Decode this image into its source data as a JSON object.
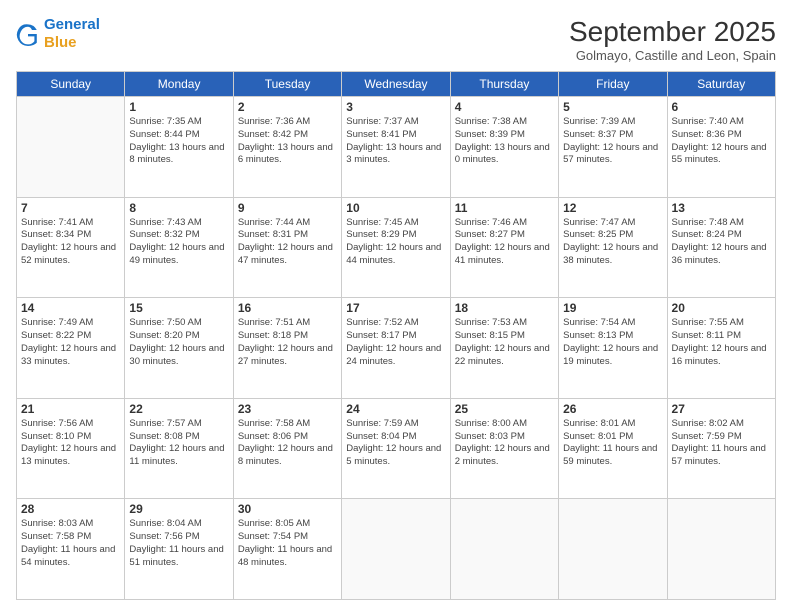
{
  "header": {
    "logo_line1": "General",
    "logo_line2": "Blue",
    "month_title": "September 2025",
    "location": "Golmayo, Castille and Leon, Spain"
  },
  "weekdays": [
    "Sunday",
    "Monday",
    "Tuesday",
    "Wednesday",
    "Thursday",
    "Friday",
    "Saturday"
  ],
  "weeks": [
    [
      {
        "day": null,
        "info": null
      },
      {
        "day": "1",
        "info": "Sunrise: 7:35 AM\nSunset: 8:44 PM\nDaylight: 13 hours\nand 8 minutes."
      },
      {
        "day": "2",
        "info": "Sunrise: 7:36 AM\nSunset: 8:42 PM\nDaylight: 13 hours\nand 6 minutes."
      },
      {
        "day": "3",
        "info": "Sunrise: 7:37 AM\nSunset: 8:41 PM\nDaylight: 13 hours\nand 3 minutes."
      },
      {
        "day": "4",
        "info": "Sunrise: 7:38 AM\nSunset: 8:39 PM\nDaylight: 13 hours\nand 0 minutes."
      },
      {
        "day": "5",
        "info": "Sunrise: 7:39 AM\nSunset: 8:37 PM\nDaylight: 12 hours\nand 57 minutes."
      },
      {
        "day": "6",
        "info": "Sunrise: 7:40 AM\nSunset: 8:36 PM\nDaylight: 12 hours\nand 55 minutes."
      }
    ],
    [
      {
        "day": "7",
        "info": "Sunrise: 7:41 AM\nSunset: 8:34 PM\nDaylight: 12 hours\nand 52 minutes."
      },
      {
        "day": "8",
        "info": "Sunrise: 7:43 AM\nSunset: 8:32 PM\nDaylight: 12 hours\nand 49 minutes."
      },
      {
        "day": "9",
        "info": "Sunrise: 7:44 AM\nSunset: 8:31 PM\nDaylight: 12 hours\nand 47 minutes."
      },
      {
        "day": "10",
        "info": "Sunrise: 7:45 AM\nSunset: 8:29 PM\nDaylight: 12 hours\nand 44 minutes."
      },
      {
        "day": "11",
        "info": "Sunrise: 7:46 AM\nSunset: 8:27 PM\nDaylight: 12 hours\nand 41 minutes."
      },
      {
        "day": "12",
        "info": "Sunrise: 7:47 AM\nSunset: 8:25 PM\nDaylight: 12 hours\nand 38 minutes."
      },
      {
        "day": "13",
        "info": "Sunrise: 7:48 AM\nSunset: 8:24 PM\nDaylight: 12 hours\nand 36 minutes."
      }
    ],
    [
      {
        "day": "14",
        "info": "Sunrise: 7:49 AM\nSunset: 8:22 PM\nDaylight: 12 hours\nand 33 minutes."
      },
      {
        "day": "15",
        "info": "Sunrise: 7:50 AM\nSunset: 8:20 PM\nDaylight: 12 hours\nand 30 minutes."
      },
      {
        "day": "16",
        "info": "Sunrise: 7:51 AM\nSunset: 8:18 PM\nDaylight: 12 hours\nand 27 minutes."
      },
      {
        "day": "17",
        "info": "Sunrise: 7:52 AM\nSunset: 8:17 PM\nDaylight: 12 hours\nand 24 minutes."
      },
      {
        "day": "18",
        "info": "Sunrise: 7:53 AM\nSunset: 8:15 PM\nDaylight: 12 hours\nand 22 minutes."
      },
      {
        "day": "19",
        "info": "Sunrise: 7:54 AM\nSunset: 8:13 PM\nDaylight: 12 hours\nand 19 minutes."
      },
      {
        "day": "20",
        "info": "Sunrise: 7:55 AM\nSunset: 8:11 PM\nDaylight: 12 hours\nand 16 minutes."
      }
    ],
    [
      {
        "day": "21",
        "info": "Sunrise: 7:56 AM\nSunset: 8:10 PM\nDaylight: 12 hours\nand 13 minutes."
      },
      {
        "day": "22",
        "info": "Sunrise: 7:57 AM\nSunset: 8:08 PM\nDaylight: 12 hours\nand 11 minutes."
      },
      {
        "day": "23",
        "info": "Sunrise: 7:58 AM\nSunset: 8:06 PM\nDaylight: 12 hours\nand 8 minutes."
      },
      {
        "day": "24",
        "info": "Sunrise: 7:59 AM\nSunset: 8:04 PM\nDaylight: 12 hours\nand 5 minutes."
      },
      {
        "day": "25",
        "info": "Sunrise: 8:00 AM\nSunset: 8:03 PM\nDaylight: 12 hours\nand 2 minutes."
      },
      {
        "day": "26",
        "info": "Sunrise: 8:01 AM\nSunset: 8:01 PM\nDaylight: 11 hours\nand 59 minutes."
      },
      {
        "day": "27",
        "info": "Sunrise: 8:02 AM\nSunset: 7:59 PM\nDaylight: 11 hours\nand 57 minutes."
      }
    ],
    [
      {
        "day": "28",
        "info": "Sunrise: 8:03 AM\nSunset: 7:58 PM\nDaylight: 11 hours\nand 54 minutes."
      },
      {
        "day": "29",
        "info": "Sunrise: 8:04 AM\nSunset: 7:56 PM\nDaylight: 11 hours\nand 51 minutes."
      },
      {
        "day": "30",
        "info": "Sunrise: 8:05 AM\nSunset: 7:54 PM\nDaylight: 11 hours\nand 48 minutes."
      },
      {
        "day": null,
        "info": null
      },
      {
        "day": null,
        "info": null
      },
      {
        "day": null,
        "info": null
      },
      {
        "day": null,
        "info": null
      }
    ]
  ]
}
